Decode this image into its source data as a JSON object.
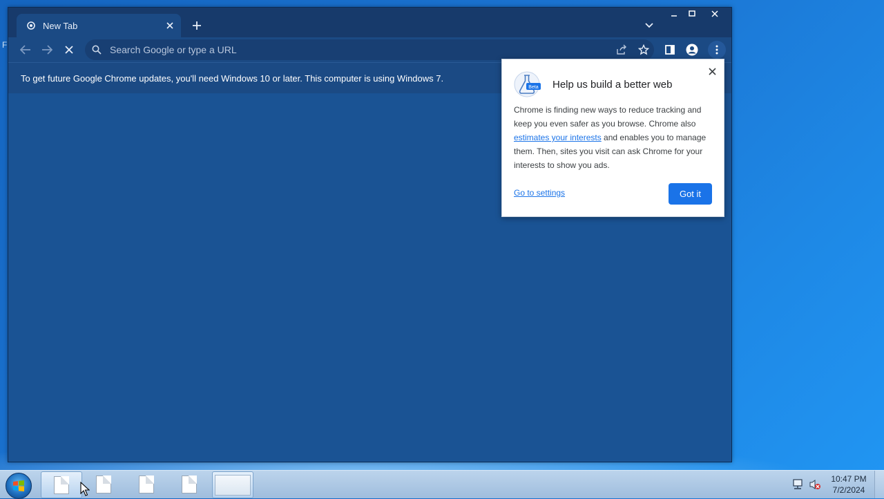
{
  "desktop": {
    "fragment_text": "F"
  },
  "browser": {
    "tab": {
      "title": "New Tab",
      "favicon": "chrome-favicon-icon",
      "close": "close-icon"
    },
    "new_tab_icon": "plus-icon",
    "tab_search_icon": "chevron-down-icon",
    "window_controls": [
      "minimize-icon",
      "maximize-icon",
      "close-icon"
    ],
    "toolbar": {
      "back_icon": "arrow-left-icon",
      "forward_icon": "arrow-right-icon",
      "stop_icon": "stop-x-icon",
      "omnibox_placeholder": "Search Google or type a URL",
      "right_icons": [
        "share-icon",
        "bookmark-star-icon",
        "side-panel-icon",
        "profile-icon",
        "menu-kebab-icon"
      ]
    },
    "infobar_text": "To get future Google Chrome updates, you'll need Windows 10 or later. This computer is using Windows 7.",
    "colors": {
      "accent": "#1a73e8",
      "window_bg": "#1a5394",
      "tabstrip": "#173a6b"
    }
  },
  "bubble": {
    "title": "Help us build a better web",
    "icon_badge": "Beta",
    "body_pre": "Chrome is finding new ways to reduce tracking and keep you even safer as you browse. Chrome also ",
    "body_link": "estimates your interests",
    "body_post": " and enables you to manage them. Then, sites you visit can ask Chrome for your interests to show you ads.",
    "settings_link": "Go to settings",
    "got_it": "Got it"
  },
  "taskbar": {
    "start": "windows-start-orb-icon",
    "buttons": [
      "document-icon",
      "document-icon",
      "document-icon",
      "document-icon",
      "window-thumbnail-icon"
    ],
    "tray_icons": [
      "network-icon",
      "volume-muted-icon"
    ],
    "clock_time": "10:47 PM",
    "clock_date": "7/2/2024"
  }
}
